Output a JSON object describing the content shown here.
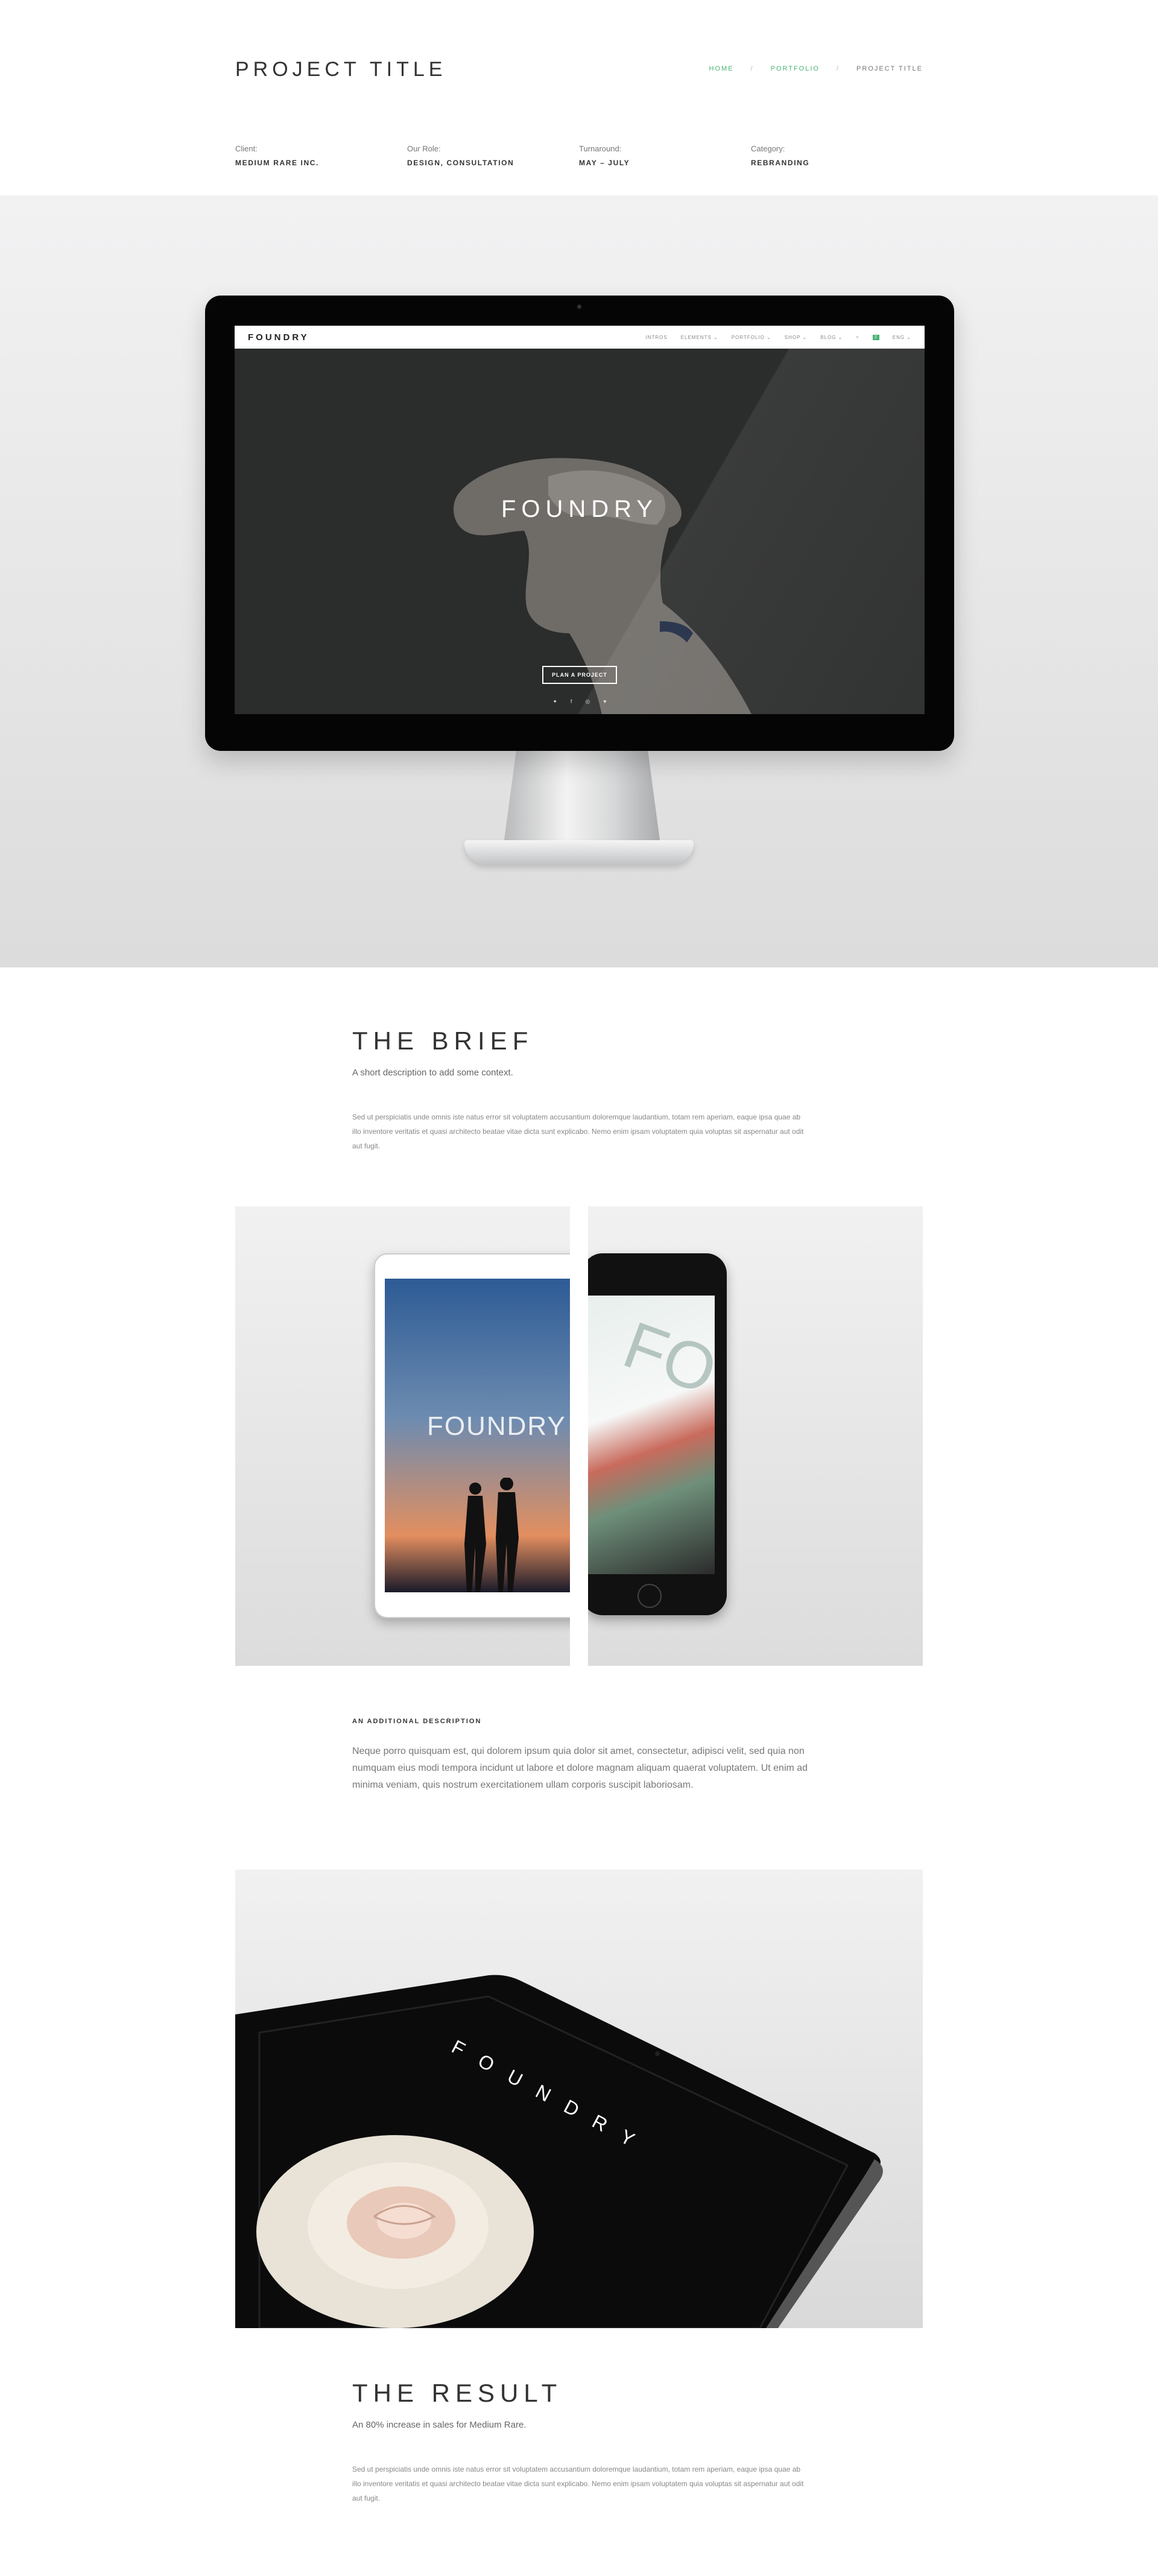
{
  "header": {
    "title": "PROJECT TITLE",
    "breadcrumbs": [
      {
        "label": "HOME"
      },
      {
        "label": "PORTFOLIO"
      },
      {
        "label": "PROJECT TITLE"
      }
    ],
    "separator": "/"
  },
  "meta": [
    {
      "label": "Client:",
      "value": "MEDIUM RARE INC."
    },
    {
      "label": "Our Role:",
      "value": "DESIGN, CONSULTATION"
    },
    {
      "label": "Turnaround:",
      "value": "MAY – JULY"
    },
    {
      "label": "Category:",
      "value": "REBRANDING"
    }
  ],
  "hero": {
    "screen_logo": "FOUNDRY",
    "screen_menu": [
      "INTROS",
      "ELEMENTS ⌄",
      "PORTFOLIO ⌄",
      "SHOP ⌄",
      "BLOG ⌄",
      "⌕",
      "2",
      "ENG ⌄"
    ],
    "headline": "FOUNDRY",
    "button": "PLAN A PROJECT",
    "socials": [
      "✦",
      "f",
      "◎",
      "♥"
    ]
  },
  "brief": {
    "heading": "THE BRIEF",
    "lead": "A short description to add some context.",
    "body": "Sed ut perspiciatis unde omnis iste natus error sit voluptatem accusantium doloremque laudantium, totam rem aperiam, eaque ipsa quae ab illo inventore veritatis et quasi architecto beatae vitae dicta sunt explicabo. Nemo enim ipsam voluptatem quia voluptas sit aspernatur aut odit aut fugit."
  },
  "devices": {
    "ipad_text": "FOUNDRY",
    "phone_text": "FO"
  },
  "additional": {
    "label": "AN ADDITIONAL DESCRIPTION",
    "body": "Neque porro quisquam est, qui dolorem ipsum quia dolor sit amet, consectetur, adipisci velit, sed quia non numquam eius modi tempora incidunt ut labore et dolore magnam aliquam quaerat voluptatem. Ut enim ad minima veniam, quis nostrum exercitationem ullam corporis suscipit laboriosam."
  },
  "tablet_showcase": {
    "text": "FOUNDRY"
  },
  "result": {
    "heading": "THE RESULT",
    "lead": "An 80% increase in sales for Medium Rare.",
    "body": "Sed ut perspiciatis unde omnis iste natus error sit voluptatem accusantium doloremque laudantium, totam rem aperiam, eaque ipsa quae ab illo inventore veritatis et quasi architecto beatae vitae dicta sunt explicabo. Nemo enim ipsam voluptatem quia voluptas sit aspernatur aut odit aut fugit."
  },
  "colors": {
    "accent": "#47b475",
    "text": "#333333",
    "muted": "#888888"
  }
}
